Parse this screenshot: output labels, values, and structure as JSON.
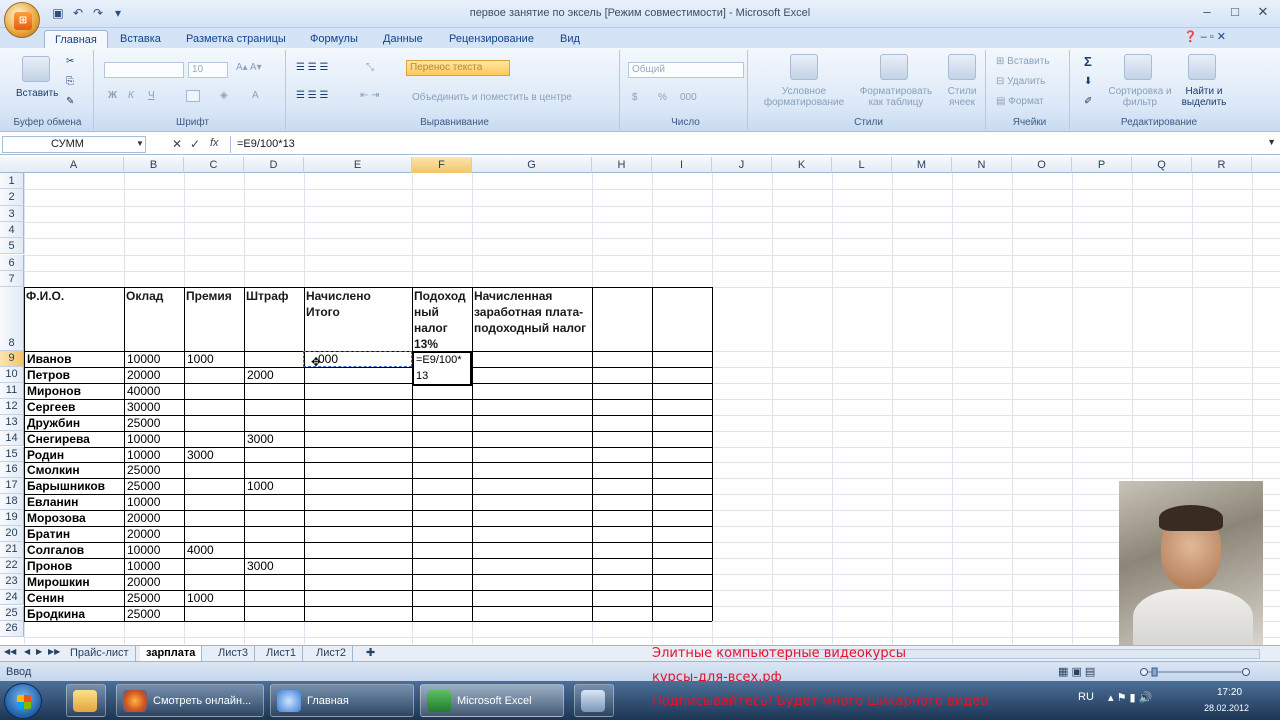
{
  "window": {
    "title": "первое занятие по эксель  [Режим совместимости] - Microsoft Excel",
    "office_button": "Office",
    "minimize": "–",
    "maximize": "□",
    "close": "✕"
  },
  "ribbon": {
    "tabs": [
      "Главная",
      "Вставка",
      "Разметка страницы",
      "Формулы",
      "Данные",
      "Рецензирование",
      "Вид"
    ],
    "active_tab": "Главная",
    "groups": {
      "clipboard": {
        "label": "Буфер обмена",
        "paste": "Вставить"
      },
      "font": {
        "label": "Шрифт",
        "font_size": "10",
        "bold": "Ж",
        "italic": "К",
        "underline": "Ч"
      },
      "alignment": {
        "label": "Выравнивание",
        "wrap_text": "Перенос текста",
        "merge": "Объединить и поместить в центре"
      },
      "number": {
        "label": "Число",
        "format": "Общий",
        "percent": "%",
        "thousands": "000"
      },
      "styles": {
        "label": "Стили",
        "conditional": "Условное форматирование",
        "as_table": "Форматировать как таблицу",
        "cell_styles": "Стили ячеек"
      },
      "cells": {
        "label": "Ячейки",
        "insert": "Вставить",
        "delete": "Удалить",
        "format": "Формат"
      },
      "editing": {
        "label": "Редактирование",
        "sum": "Σ",
        "sort": "Сортировка и фильтр",
        "find": "Найти и выделить"
      }
    }
  },
  "formula_bar": {
    "name_box": "СУММ",
    "cancel": "✕",
    "enter": "✓",
    "fx": "fx",
    "formula": "=E9/100*13"
  },
  "columns": [
    "A",
    "B",
    "C",
    "D",
    "E",
    "F",
    "G",
    "H",
    "I",
    "J",
    "K",
    "L",
    "M",
    "N",
    "O",
    "P",
    "Q",
    "R"
  ],
  "selected_column": "F",
  "row_numbers": [
    "1",
    "2",
    "3",
    "4",
    "5",
    "6",
    "7",
    "8",
    "9",
    "10",
    "11",
    "12",
    "13",
    "14",
    "15",
    "16",
    "17",
    "18",
    "19",
    "20",
    "21",
    "22",
    "23",
    "24",
    "25",
    "26"
  ],
  "selected_row": "9",
  "table": {
    "headers": {
      "fio": "Ф.И.О.",
      "oklad": "Оклад",
      "premia": "Премия",
      "shtraf": "Штраф",
      "nachisleno": "Начислено Итого",
      "podohod": "Подоходный налог 13%",
      "zarplata": "Начисленная заработная плата-подоходный налог"
    },
    "header_lines": {
      "podohod": [
        "Подоход",
        "ный",
        "налог",
        "13%"
      ],
      "zarplata": [
        "Начисленная",
        "заработная плата-",
        "подоходный налог"
      ],
      "nachisleno": [
        "Начислено",
        "Итого"
      ]
    },
    "rows": [
      {
        "name": "Иванов",
        "oklad": "10000",
        "premia": "1000",
        "shtraf": ""
      },
      {
        "name": "Петров",
        "oklad": "20000",
        "premia": "",
        "shtraf": "2000"
      },
      {
        "name": "Миронов",
        "oklad": "40000",
        "premia": "",
        "shtraf": ""
      },
      {
        "name": "Сергеев",
        "oklad": "30000",
        "premia": "",
        "shtraf": ""
      },
      {
        "name": "Дружбин",
        "oklad": "25000",
        "premia": "",
        "shtraf": ""
      },
      {
        "name": "Снегирева",
        "oklad": "10000",
        "premia": "",
        "shtraf": "3000"
      },
      {
        "name": "Родин",
        "oklad": "10000",
        "premia": "3000",
        "shtraf": ""
      },
      {
        "name": "Смолкин",
        "oklad": "25000",
        "premia": "",
        "shtraf": ""
      },
      {
        "name": "Барышников",
        "oklad": "25000",
        "premia": "",
        "shtraf": "1000"
      },
      {
        "name": "Евланин",
        "oklad": "10000",
        "premia": "",
        "shtraf": ""
      },
      {
        "name": "Морозова",
        "oklad": "20000",
        "premia": "",
        "shtraf": ""
      },
      {
        "name": "Братин",
        "oklad": "20000",
        "premia": "",
        "shtraf": ""
      },
      {
        "name": "Солгалов",
        "oklad": "10000",
        "premia": "4000",
        "shtraf": ""
      },
      {
        "name": "Пронов",
        "oklad": "10000",
        "premia": "",
        "shtraf": "3000"
      },
      {
        "name": "Мирошкин",
        "oklad": "20000",
        "premia": "",
        "shtraf": ""
      },
      {
        "name": "Сенин",
        "oklad": "25000",
        "premia": "1000",
        "shtraf": ""
      },
      {
        "name": "Бродкина",
        "oklad": "25000",
        "premia": "",
        "shtraf": ""
      }
    ],
    "e9_partial": "000",
    "editing_cell": {
      "line1": "=E9/100*",
      "line2": "13"
    }
  },
  "sheets": [
    "Прайс-лист",
    "зарплата",
    "Лист3",
    "Лист1",
    "Лист2"
  ],
  "active_sheet": "зарплата",
  "status": {
    "mode": "Ввод"
  },
  "promo": [
    "Элитные компьютерные видеокурсы",
    "курсы-для-всех.рф",
    "Подписывайтесь! Будет много шикарного видео"
  ],
  "taskbar": {
    "items": [
      {
        "label": "Смотреть онлайн...",
        "icon": "firefox-icon"
      },
      {
        "label": "Главная",
        "icon": "ie-icon"
      },
      {
        "label": "Microsoft Excel",
        "icon": "excel-icon"
      }
    ],
    "lang": "RU",
    "time": "17:20",
    "date": "28.02.2012"
  }
}
